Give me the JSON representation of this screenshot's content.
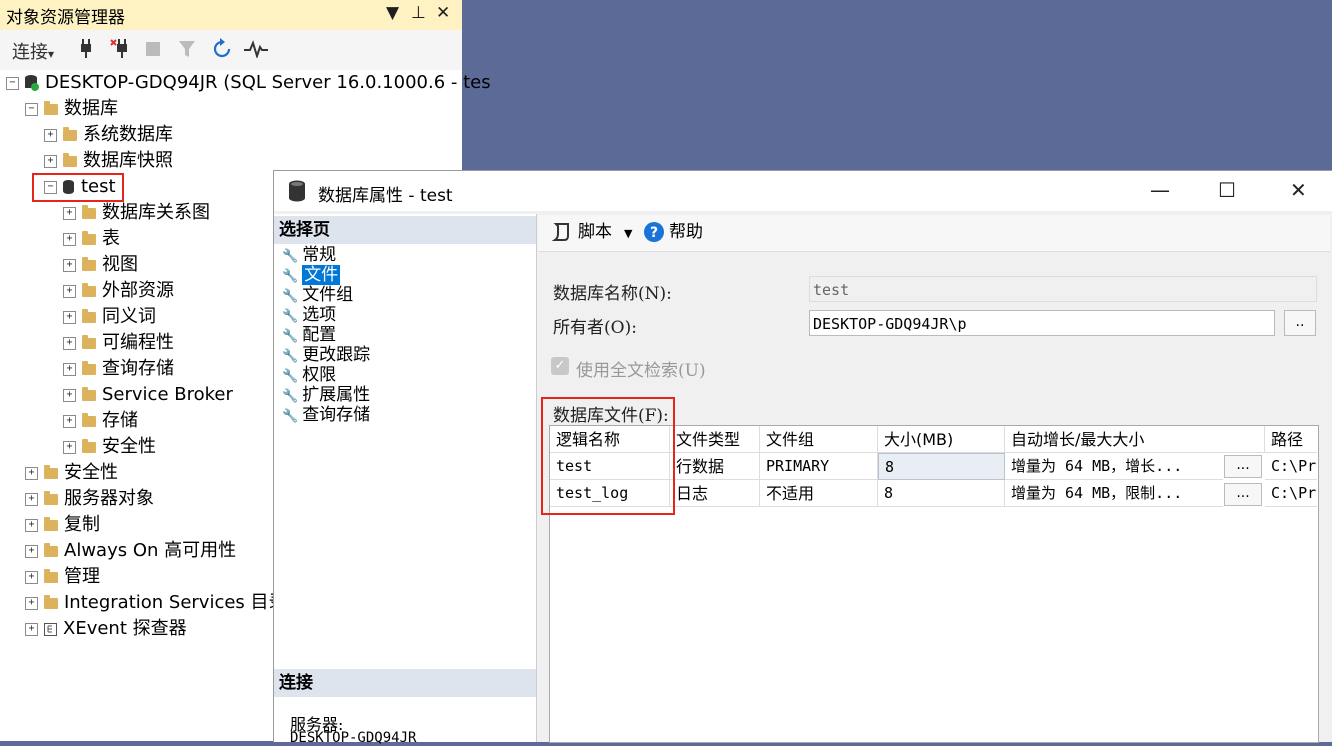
{
  "explorer": {
    "title": "对象资源管理器",
    "controls": [
      "▼",
      "⊥",
      "✕"
    ],
    "toolbar": {
      "connect_label": "连接",
      "connect_arrow": "▾"
    },
    "tree": [
      {
        "label": "DESKTOP-GDQ94JR (SQL Server 16.0.1000.6 - tes",
        "toggle": "−",
        "icon": "server-icon"
      },
      {
        "label": "数据库",
        "toggle": "−",
        "icon": "folder-icon"
      },
      {
        "label": "系统数据库",
        "toggle": "+",
        "icon": "folder-icon"
      },
      {
        "label": "数据库快照",
        "toggle": "+",
        "icon": "folder-icon"
      },
      {
        "label": "test",
        "toggle": "−",
        "icon": "database-icon"
      },
      {
        "label": "数据库关系图",
        "toggle": "+",
        "icon": "folder-icon"
      },
      {
        "label": "表",
        "toggle": "+",
        "icon": "folder-icon"
      },
      {
        "label": "视图",
        "toggle": "+",
        "icon": "folder-icon"
      },
      {
        "label": "外部资源",
        "toggle": "+",
        "icon": "folder-icon"
      },
      {
        "label": "同义词",
        "toggle": "+",
        "icon": "folder-icon"
      },
      {
        "label": "可编程性",
        "toggle": "+",
        "icon": "folder-icon"
      },
      {
        "label": "查询存储",
        "toggle": "+",
        "icon": "folder-icon"
      },
      {
        "label": "Service Broker",
        "toggle": "+",
        "icon": "folder-icon"
      },
      {
        "label": "存储",
        "toggle": "+",
        "icon": "folder-icon"
      },
      {
        "label": "安全性",
        "toggle": "+",
        "icon": "folder-icon"
      },
      {
        "label": "安全性",
        "toggle": "+",
        "icon": "folder-icon"
      },
      {
        "label": "服务器对象",
        "toggle": "+",
        "icon": "folder-icon"
      },
      {
        "label": "复制",
        "toggle": "+",
        "icon": "folder-icon"
      },
      {
        "label": "Always On 高可用性",
        "toggle": "+",
        "icon": "folder-icon"
      },
      {
        "label": "管理",
        "toggle": "+",
        "icon": "folder-icon"
      },
      {
        "label": "Integration Services 目录",
        "toggle": "+",
        "icon": "folder-icon"
      },
      {
        "label": "XEvent 探查器",
        "toggle": "+",
        "icon": "xevent-icon"
      }
    ]
  },
  "dialog": {
    "title": "数据库属性 - test",
    "controls": [
      "—",
      "☐",
      "✕"
    ],
    "select_page_header": "选择页",
    "pages": [
      "常规",
      "文件",
      "文件组",
      "选项",
      "配置",
      "更改跟踪",
      "权限",
      "扩展属性",
      "查询存储"
    ],
    "selected_page": "文件",
    "connection_header": "连接",
    "server_label": "服务器:",
    "server_value": "DESKTOP-GDQ94JR",
    "toolbar": {
      "script_label": "脚本",
      "help_label": "帮助"
    },
    "db_name_label": "数据库名称(N):",
    "db_name_value": "test",
    "owner_label": "所有者(O):",
    "owner_value": "DESKTOP-GDQ94JR\\p",
    "browse_label": "..",
    "fulltext_label": "使用全文检索(U)",
    "files_label": "数据库文件(F):",
    "columns": [
      "逻辑名称",
      "文件类型",
      "文件组",
      "大小(MB)",
      "自动增长/最大大小",
      "路径"
    ],
    "rows": [
      {
        "name": "test",
        "type": "行数据",
        "filegroup": "PRIMARY",
        "size": "8",
        "growth": "增量为 64 MB，增长...",
        "btn": "...",
        "path": "C:\\Pr"
      },
      {
        "name": "test_log",
        "type": "日志",
        "filegroup": "不适用",
        "size": "8",
        "growth": "增量为 64 MB，限制...",
        "btn": "...",
        "path": "C:\\Pr"
      }
    ]
  }
}
